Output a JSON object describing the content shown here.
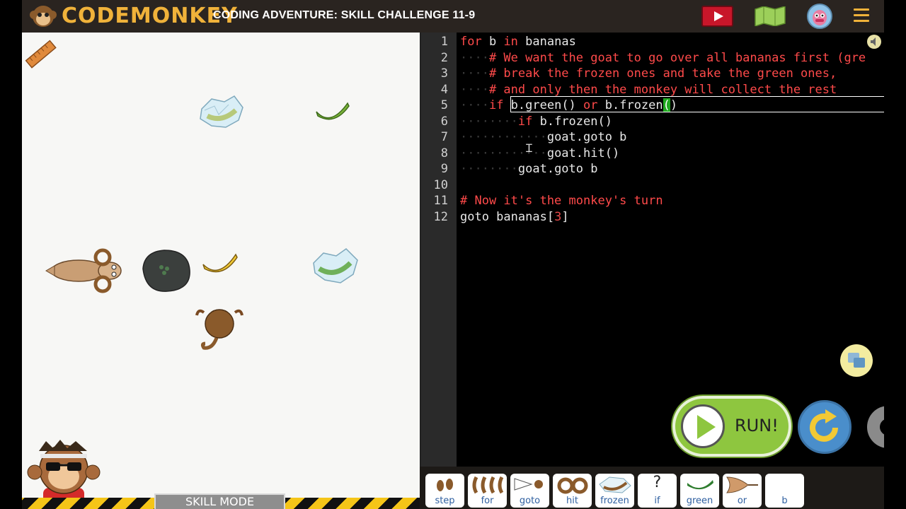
{
  "app": {
    "logo_text": "CODEMONKEY",
    "title": "CODING ADVENTURE: SKILL CHALLENGE 11-9",
    "icons": [
      "monkey-logo-icon",
      "video-icon",
      "map-icon",
      "avatar-icon",
      "menu-icon"
    ]
  },
  "game": {
    "skill_mode_label": "SKILL MODE"
  },
  "editor": {
    "line_numbers": [
      "1",
      "2",
      "3",
      "4",
      "5",
      "6",
      "7",
      "8",
      "9",
      "10",
      "11",
      "12"
    ],
    "lines": [
      {
        "indent": "",
        "tokens": [
          {
            "t": "for",
            "c": "kw"
          },
          {
            "t": " b ",
            "c": ""
          },
          {
            "t": "in",
            "c": "kw"
          },
          {
            "t": " bananas",
            "c": ""
          }
        ]
      },
      {
        "indent": "····",
        "tokens": [
          {
            "t": "# We want the goat to go over all bananas first (gre",
            "c": "cm"
          }
        ]
      },
      {
        "indent": "····",
        "tokens": [
          {
            "t": "# break the frozen ones and take the green ones,",
            "c": "cm"
          }
        ]
      },
      {
        "indent": "····",
        "tokens": [
          {
            "t": "# and only then the monkey will collect the rest",
            "c": "cm"
          }
        ]
      },
      {
        "indent": "····",
        "tokens": [
          {
            "t": "if",
            "c": "kw"
          },
          {
            "t": " b.green() ",
            "c": ""
          },
          {
            "t": "or",
            "c": "kw"
          },
          {
            "t": " b.frozen",
            "c": ""
          },
          {
            "t": "(",
            "c": "paren-hl"
          },
          {
            "t": ")",
            "c": ""
          }
        ]
      },
      {
        "indent": "········",
        "tokens": [
          {
            "t": "if",
            "c": "kw"
          },
          {
            "t": " b.frozen()",
            "c": ""
          }
        ]
      },
      {
        "indent": "············",
        "tokens": [
          {
            "t": "goat.goto b",
            "c": ""
          }
        ]
      },
      {
        "indent": "············",
        "tokens": [
          {
            "t": "goat.hit()",
            "c": ""
          }
        ]
      },
      {
        "indent": "········",
        "tokens": [
          {
            "t": "goat.goto b",
            "c": ""
          }
        ]
      },
      {
        "indent": "",
        "tokens": []
      },
      {
        "indent": "",
        "tokens": [
          {
            "t": "# Now it's the monkey's turn",
            "c": "cm"
          }
        ]
      },
      {
        "indent": "",
        "tokens": [
          {
            "t": "goto bananas[",
            "c": ""
          },
          {
            "t": "3",
            "c": "num"
          },
          {
            "t": "]",
            "c": ""
          }
        ]
      }
    ],
    "run_label": "RUN!"
  },
  "toolbar": {
    "tools": [
      {
        "label": "step",
        "icon": "footprints-icon"
      },
      {
        "label": "for",
        "icon": "bananas-icon"
      },
      {
        "label": "goto",
        "icon": "goto-icon"
      },
      {
        "label": "hit",
        "icon": "horns-icon"
      },
      {
        "label": "frozen",
        "icon": "frozen-banana-icon"
      },
      {
        "label": "if",
        "icon": "question-icon",
        "glyph": "?"
      },
      {
        "label": "green",
        "icon": "green-banana-icon"
      },
      {
        "label": "or",
        "icon": "or-gate-icon"
      },
      {
        "label": "b",
        "icon": ""
      }
    ]
  },
  "colors": {
    "brand": "#f0b23a",
    "keyword": "#ff4a4a",
    "run": "#8ec63f",
    "reset": "#4a8ecb"
  }
}
